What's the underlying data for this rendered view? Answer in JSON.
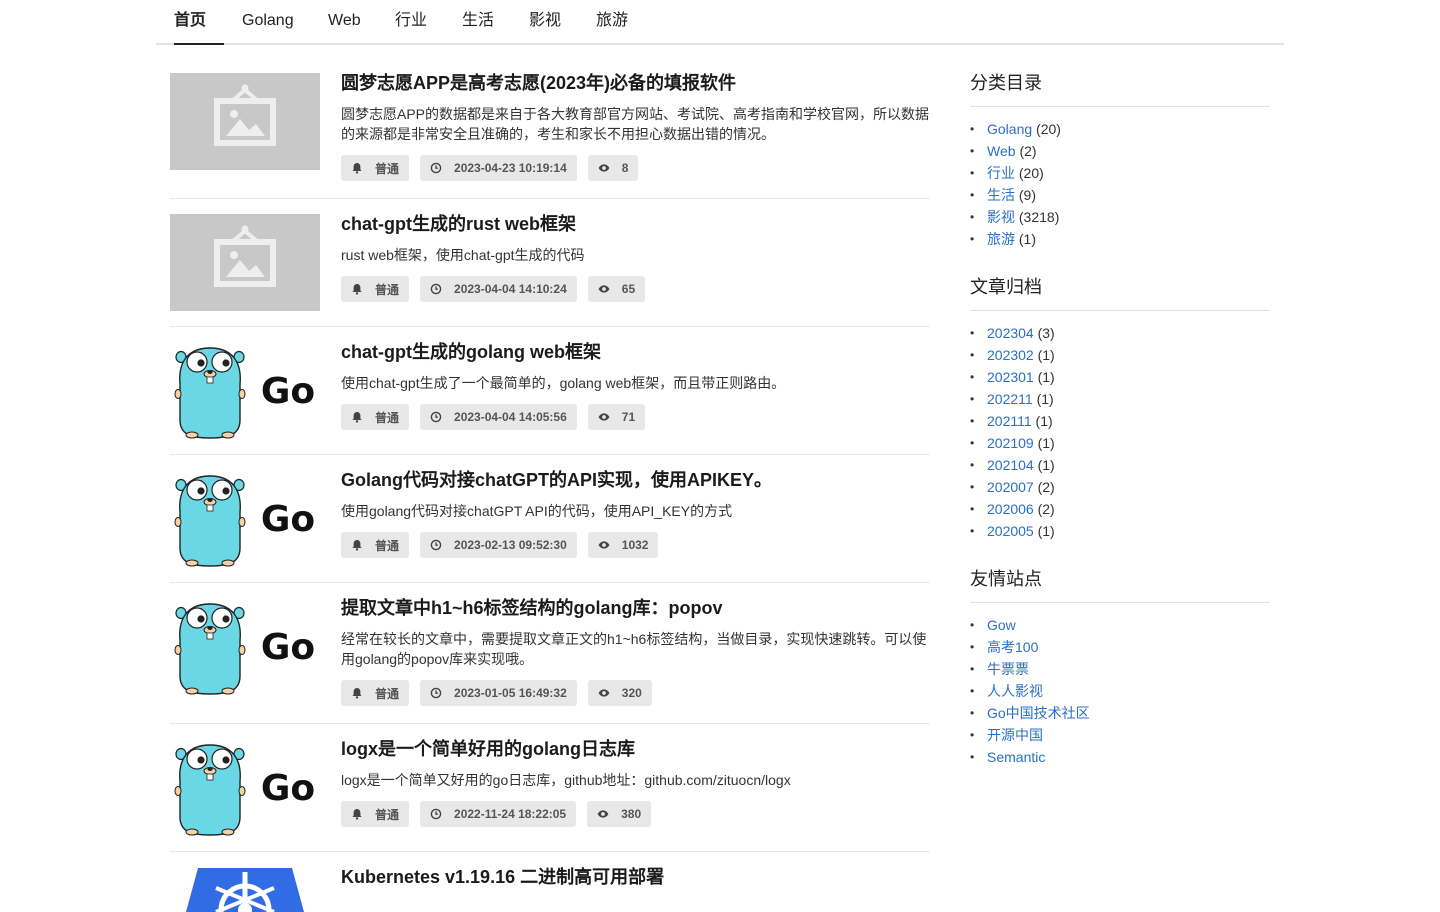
{
  "nav": {
    "items": [
      {
        "label": "首页",
        "active": true
      },
      {
        "label": "Golang"
      },
      {
        "label": "Web"
      },
      {
        "label": "行业"
      },
      {
        "label": "生活"
      },
      {
        "label": "影视"
      },
      {
        "label": "旅游"
      }
    ]
  },
  "articles": [
    {
      "title": "圆梦志愿APP是高考志愿(2023年)必备的填报软件",
      "desc": "圆梦志愿APP的数据都是来自于各大教育部官方网站、考试院、高考指南和学校官网，所以数据的来源都是非常安全且准确的，考生和家长不用担心数据出错的情况。",
      "level": "普通",
      "time": "2023-04-23 10:19:14",
      "views": "8",
      "thumb": "placeholder-image-icon"
    },
    {
      "title": "chat-gpt生成的rust web框架",
      "desc": "rust web框架，使用chat-gpt生成的代码",
      "level": "普通",
      "time": "2023-04-04 14:10:24",
      "views": "65",
      "thumb": "placeholder-image-icon"
    },
    {
      "title": "chat-gpt生成的golang web框架",
      "desc": "使用chat-gpt生成了一个最简单的，golang web框架，而且带正则路由。",
      "level": "普通",
      "time": "2023-04-04 14:05:56",
      "views": "71",
      "thumb": "go-gopher-logo",
      "logo_text": "Go"
    },
    {
      "title": "Golang代码对接chatGPT的API实现，使用APIKEY。",
      "desc": "使用golang代码对接chatGPT API的代码，使用API_KEY的方式",
      "level": "普通",
      "time": "2023-02-13 09:52:30",
      "views": "1032",
      "thumb": "go-gopher-logo",
      "logo_text": "Go"
    },
    {
      "title": "提取文章中h1~h6标签结构的golang库：popov",
      "desc": "经常在较长的文章中，需要提取文章正文的h1~h6标签结构，当做目录，实现快速跳转。可以使用golang的popov库来实现哦。",
      "level": "普通",
      "time": "2023-01-05 16:49:32",
      "views": "320",
      "thumb": "go-gopher-logo",
      "logo_text": "Go"
    },
    {
      "title": "logx是一个简单好用的golang日志库",
      "desc": "logx是一个简单又好用的go日志库，github地址：github.com/zituocn/logx",
      "level": "普通",
      "time": "2022-11-24 18:22:05",
      "views": "380",
      "thumb": "go-gopher-logo",
      "logo_text": "Go"
    },
    {
      "title": "Kubernetes v1.19.16 二进制高可用部署",
      "thumb": "kubernetes-logo"
    }
  ],
  "sidebar": {
    "categories": {
      "title": "分类目录",
      "items": [
        {
          "name": "Golang",
          "count": "(20)"
        },
        {
          "name": "Web",
          "count": "(2)"
        },
        {
          "name": "行业",
          "count": "(20)"
        },
        {
          "name": "生活",
          "count": "(9)"
        },
        {
          "name": "影视",
          "count": "(3218)"
        },
        {
          "name": "旅游",
          "count": "(1)"
        }
      ]
    },
    "archives": {
      "title": "文章归档",
      "items": [
        {
          "name": "202304",
          "count": "(3)"
        },
        {
          "name": "202302",
          "count": "(1)"
        },
        {
          "name": "202301",
          "count": "(1)"
        },
        {
          "name": "202211",
          "count": "(1)"
        },
        {
          "name": "202111",
          "count": "(1)"
        },
        {
          "name": "202109",
          "count": "(1)"
        },
        {
          "name": "202104",
          "count": "(1)"
        },
        {
          "name": "202007",
          "count": "(2)"
        },
        {
          "name": "202006",
          "count": "(2)"
        },
        {
          "name": "202005",
          "count": "(1)"
        }
      ]
    },
    "links": {
      "title": "友情站点",
      "items": [
        {
          "name": "Gow"
        },
        {
          "name": "高考100"
        },
        {
          "name": "牛票票"
        },
        {
          "name": "人人影视"
        },
        {
          "name": "Go中国技术社区"
        },
        {
          "name": "开源中国"
        },
        {
          "name": "Semantic"
        }
      ]
    }
  },
  "colors": {
    "link": "#2b6fc4",
    "tag_bg": "#e8e8e8",
    "placeholder": "#c8c8c8",
    "gopher": "#6ad7e5"
  }
}
